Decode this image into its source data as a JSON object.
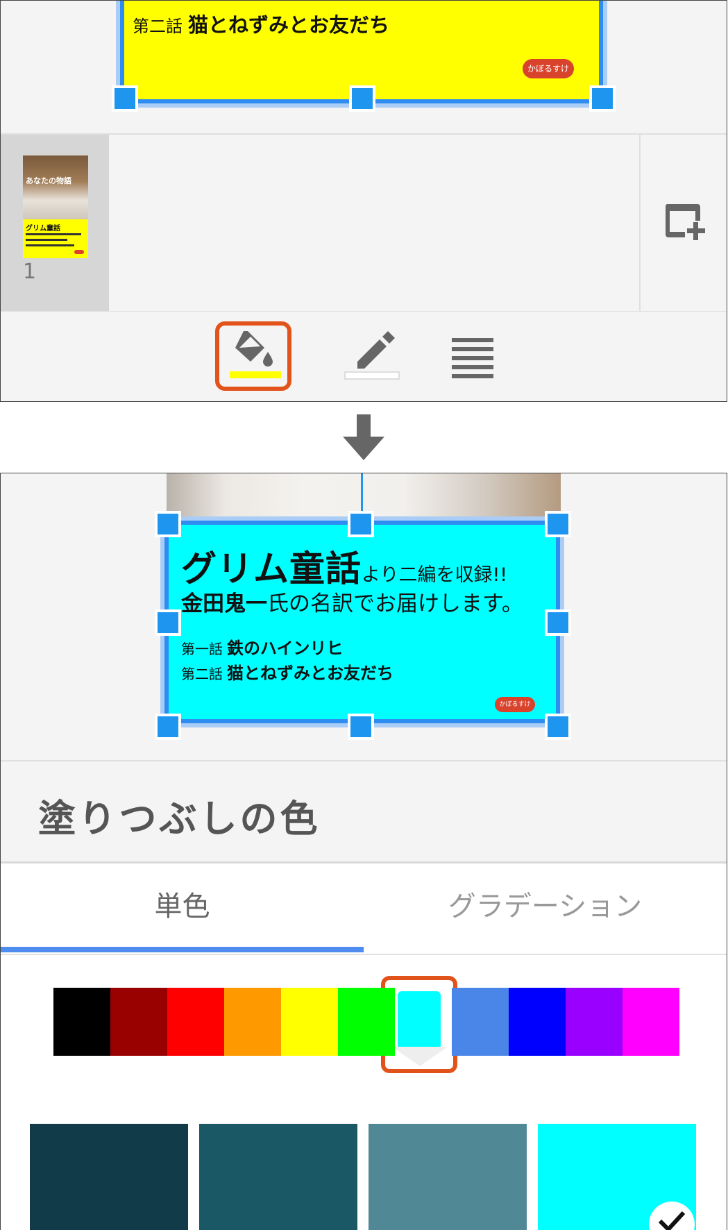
{
  "top_panel": {
    "canvas": {
      "text_box_color": "#ffff00",
      "story_2_number": "第二話",
      "story_2_title": "猫とねずみとお友だち",
      "publisher_badge": "かぼるすけ"
    },
    "slide_strip": {
      "thumbnail_title": "あなたの物語",
      "thumbnail_subtitle": "グリム童話",
      "slide_number": "1",
      "add_slide_icon": "add-slide-icon"
    },
    "toolbar": {
      "fill_icon": "paint-bucket-icon",
      "fill_color": "#ffff00",
      "line_icon": "pencil-icon",
      "text_icon": "text-format-icon"
    }
  },
  "arrow_icon": "arrow-down-icon",
  "bottom_panel": {
    "canvas": {
      "text_box_color": "#00ffff",
      "headline_big": "グリム童話",
      "headline_small": "より二編を収録!!",
      "translator_bold": "金田鬼一",
      "translator_rest": "氏の名訳でお届けします。",
      "story_1_number": "第一話",
      "story_1_title": "鉄のハインリヒ",
      "story_2_number": "第二話",
      "story_2_title": "猫とねずみとお友だち",
      "publisher_badge": "かぼるすけ"
    },
    "fill_panel": {
      "title": "塗りつぶしの色",
      "tabs": [
        {
          "label": "単色",
          "active": true
        },
        {
          "label": "グラデーション",
          "active": false
        }
      ],
      "palette": [
        "#000000",
        "#990000",
        "#ff0000",
        "#ff9900",
        "#ffff00",
        "#00ff00",
        "#00ffff",
        "#4a86e8",
        "#0000ff",
        "#9900ff",
        "#ff00ff"
      ],
      "selected_color": "#00ffff",
      "shades": [
        "#123b4a",
        "#1b5866",
        "#508995",
        "#00ffff"
      ],
      "selected_shade_index": 3
    }
  }
}
